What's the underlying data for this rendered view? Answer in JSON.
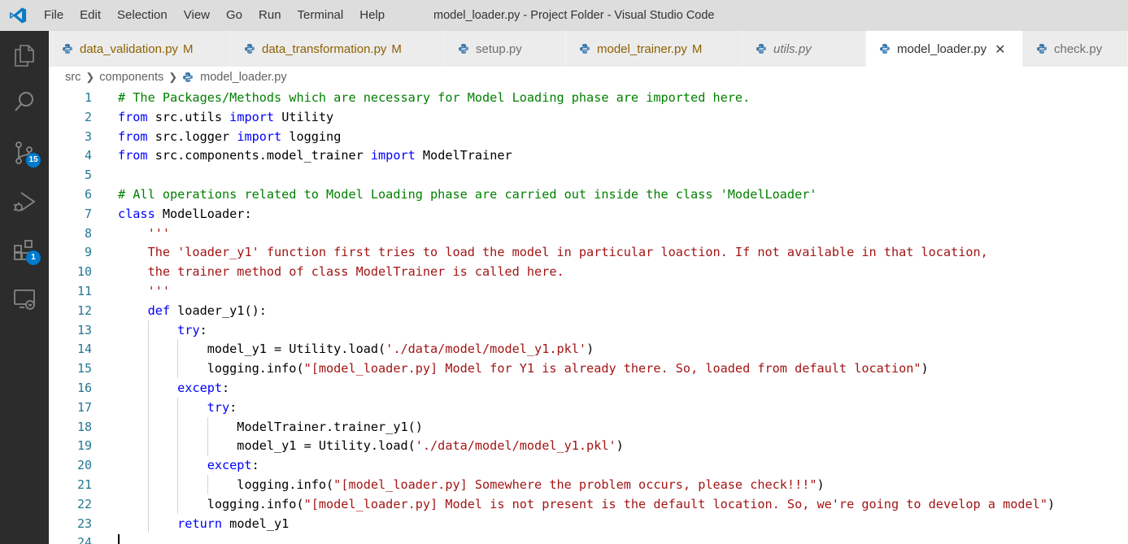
{
  "titlebar": {
    "menu": [
      "File",
      "Edit",
      "Selection",
      "View",
      "Go",
      "Run",
      "Terminal",
      "Help"
    ],
    "window_title": "model_loader.py - Project Folder - Visual Studio Code"
  },
  "activitybar": {
    "items": [
      "explorer-icon",
      "search-icon",
      "source-control-icon",
      "run-debug-icon",
      "extensions-icon",
      "remote-explorer-icon"
    ],
    "source_control_badge": "15",
    "extensions_badge": "1"
  },
  "tabs": [
    {
      "label": "data_validation.py",
      "flag": "M"
    },
    {
      "label": "data_transformation.py",
      "flag": "M"
    },
    {
      "label": "setup.py",
      "flag": ""
    },
    {
      "label": "model_trainer.py",
      "flag": "M"
    },
    {
      "label": "utils.py",
      "flag": ""
    },
    {
      "label": "model_loader.py",
      "flag": "",
      "close": "✕"
    },
    {
      "label": "check.py",
      "flag": ""
    }
  ],
  "breadcrumb": [
    "src",
    "components",
    "model_loader.py"
  ],
  "editor": {
    "line_numbers": [
      "1",
      "2",
      "3",
      "4",
      "5",
      "6",
      "7",
      "8",
      "9",
      "10",
      "11",
      "12",
      "13",
      "14",
      "15",
      "16",
      "17",
      "18",
      "19",
      "20",
      "21",
      "22",
      "23",
      "24"
    ],
    "lines": [
      [
        {
          "t": "# The Packages/Methods which are necessary for Model Loading phase are imported here.",
          "c": "comment"
        }
      ],
      [
        {
          "t": "from",
          "c": "kw"
        },
        {
          "t": " src.utils ",
          "c": "plain"
        },
        {
          "t": "import",
          "c": "kw"
        },
        {
          "t": " Utility",
          "c": "plain"
        }
      ],
      [
        {
          "t": "from",
          "c": "kw"
        },
        {
          "t": " src.logger ",
          "c": "plain"
        },
        {
          "t": "import",
          "c": "kw"
        },
        {
          "t": " logging",
          "c": "plain"
        }
      ],
      [
        {
          "t": "from",
          "c": "kw"
        },
        {
          "t": " src.components.model_trainer ",
          "c": "plain"
        },
        {
          "t": "import",
          "c": "kw"
        },
        {
          "t": " ModelTrainer",
          "c": "plain"
        }
      ],
      [],
      [
        {
          "t": "# All operations related to Model Loading phase are carried out inside the class 'ModelLoader'",
          "c": "comment"
        }
      ],
      [
        {
          "t": "class",
          "c": "kw"
        },
        {
          "t": " ModelLoader:",
          "c": "plain"
        }
      ],
      [
        {
          "t": "    '''",
          "c": "str"
        }
      ],
      [
        {
          "t": "    The 'loader_y1' function first tries to load the model in particular loaction. If not available in that location,",
          "c": "str"
        }
      ],
      [
        {
          "t": "    the trainer method of class ModelTrainer is called here.",
          "c": "str"
        }
      ],
      [
        {
          "t": "    '''",
          "c": "str"
        }
      ],
      [
        {
          "t": "    ",
          "c": "plain"
        },
        {
          "t": "def",
          "c": "kw"
        },
        {
          "t": " loader_y1():",
          "c": "plain"
        }
      ],
      [
        {
          "t": "        ",
          "c": "plain"
        },
        {
          "t": "try",
          "c": "kw"
        },
        {
          "t": ":",
          "c": "plain"
        }
      ],
      [
        {
          "t": "            model_y1 = Utility.load(",
          "c": "plain"
        },
        {
          "t": "'./data/model/model_y1.pkl'",
          "c": "str"
        },
        {
          "t": ")",
          "c": "plain"
        }
      ],
      [
        {
          "t": "            logging.info(",
          "c": "plain"
        },
        {
          "t": "\"[model_loader.py] Model for Y1 is already there. So, loaded from default location\"",
          "c": "str"
        },
        {
          "t": ")",
          "c": "plain"
        }
      ],
      [
        {
          "t": "        ",
          "c": "plain"
        },
        {
          "t": "except",
          "c": "kw"
        },
        {
          "t": ":",
          "c": "plain"
        }
      ],
      [
        {
          "t": "            ",
          "c": "plain"
        },
        {
          "t": "try",
          "c": "kw"
        },
        {
          "t": ":",
          "c": "plain"
        }
      ],
      [
        {
          "t": "                ModelTrainer.trainer_y1()",
          "c": "plain"
        }
      ],
      [
        {
          "t": "                model_y1 = Utility.load(",
          "c": "plain"
        },
        {
          "t": "'./data/model/model_y1.pkl'",
          "c": "str"
        },
        {
          "t": ")",
          "c": "plain"
        }
      ],
      [
        {
          "t": "            ",
          "c": "plain"
        },
        {
          "t": "except",
          "c": "kw"
        },
        {
          "t": ":",
          "c": "plain"
        }
      ],
      [
        {
          "t": "                logging.info(",
          "c": "plain"
        },
        {
          "t": "\"[model_loader.py] Somewhere the problem occurs, please check!!!\"",
          "c": "str"
        },
        {
          "t": ")",
          "c": "plain"
        }
      ],
      [
        {
          "t": "            logging.info(",
          "c": "plain"
        },
        {
          "t": "\"[model_loader.py] Model is not present is the default location. So, we're going to develop a model\"",
          "c": "str"
        },
        {
          "t": ")",
          "c": "plain"
        }
      ],
      [
        {
          "t": "        ",
          "c": "plain"
        },
        {
          "t": "return",
          "c": "kw"
        },
        {
          "t": " model_y1",
          "c": "plain"
        }
      ],
      []
    ]
  },
  "colors": {
    "keyword": "#0000ff",
    "string": "#a31515",
    "comment": "#008000",
    "line_number": "#237893",
    "modified_tab": "#8e6100",
    "badge": "#007acc"
  }
}
